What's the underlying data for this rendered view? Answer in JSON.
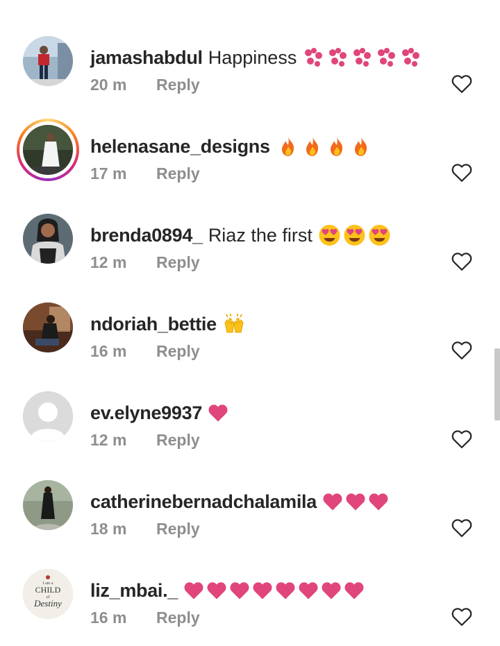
{
  "comments": [
    {
      "username": "jamashabdul",
      "text": "Happiness",
      "emoji": "sparkling-heart",
      "emoji_count": 5,
      "time": "20 m",
      "reply": "Reply",
      "has_story": false
    },
    {
      "username": "helenasane_designs",
      "text": "",
      "emoji": "fire",
      "emoji_count": 4,
      "time": "17 m",
      "reply": "Reply",
      "has_story": true
    },
    {
      "username": "brenda0894_",
      "text": "Riaz the first",
      "emoji": "heart-eyes",
      "emoji_count": 3,
      "time": "12 m",
      "reply": "Reply",
      "has_story": false
    },
    {
      "username": "ndoriah_bettie",
      "text": "",
      "emoji": "raising-hands",
      "emoji_count": 1,
      "time": "16 m",
      "reply": "Reply",
      "has_story": false
    },
    {
      "username": "ev.elyne9937",
      "text": "",
      "emoji": "heart",
      "emoji_count": 1,
      "time": "12 m",
      "reply": "Reply",
      "has_story": false
    },
    {
      "username": "catherinebernadchalamila",
      "text": "",
      "emoji": "heart",
      "emoji_count": 3,
      "time": "18 m",
      "reply": "Reply",
      "has_story": false
    },
    {
      "username": "liz_mbai._",
      "text": "",
      "emoji": "heart",
      "emoji_count": 8,
      "time": "16 m",
      "reply": "Reply",
      "has_story": false
    }
  ],
  "avatars": {
    "child_of_destiny": {
      "top": "I am a",
      "middle": "CHILD",
      "of": "of",
      "bottom": "Destiny"
    }
  },
  "colors": {
    "text": "#262626",
    "meta": "#8e8e8e",
    "heart": "#e0457b"
  }
}
